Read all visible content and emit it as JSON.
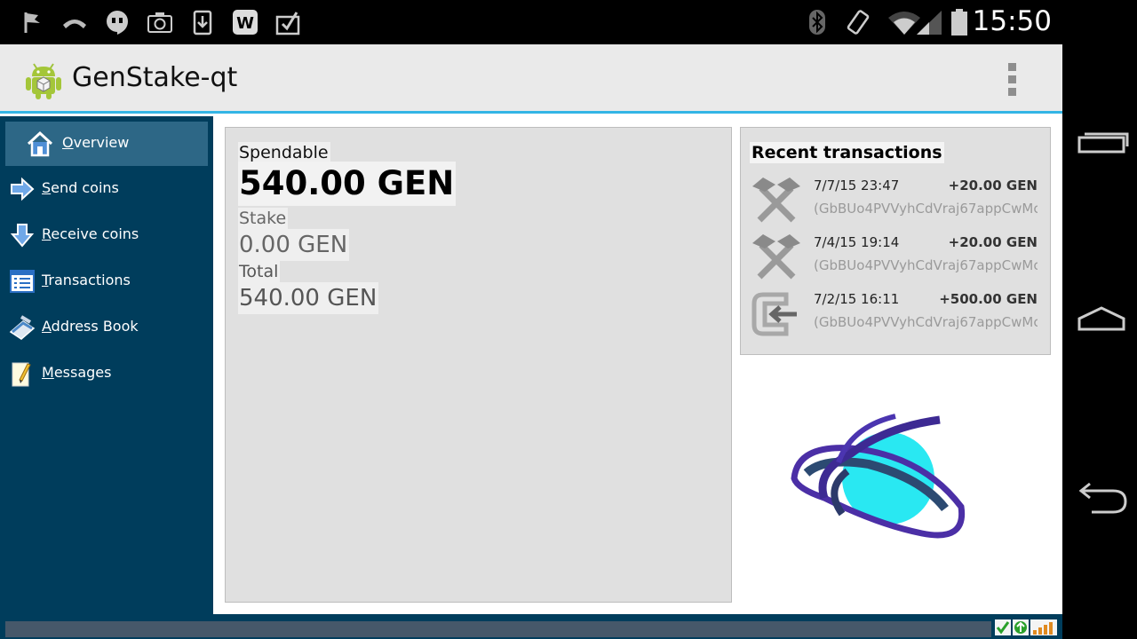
{
  "status_bar": {
    "clock": "15:50",
    "icons": [
      "notification-flag-icon",
      "missed-call-icon",
      "hangouts-icon",
      "camera-icon",
      "download-icon",
      "word-app-icon",
      "clipboard-check-icon",
      "bluetooth-icon",
      "screen-rotation-icon",
      "wifi-icon",
      "signal-icon",
      "battery-icon"
    ]
  },
  "navigation_bar": {
    "buttons": [
      "recent-apps",
      "home",
      "back"
    ]
  },
  "app": {
    "title": "GenStake-qt",
    "icon": "android-robot-icon",
    "menu_icon": "overflow-menu-icon",
    "accent_color": "#33b5e5",
    "sidebar_color": "#003d5c"
  },
  "sidebar": {
    "items": [
      {
        "label": "Overview",
        "icon": "home-icon",
        "active": true
      },
      {
        "label": "Send coins",
        "icon": "send-arrow-icon",
        "active": false
      },
      {
        "label": "Receive coins",
        "icon": "receive-arrow-icon",
        "active": false
      },
      {
        "label": "Transactions",
        "icon": "transactions-list-icon",
        "active": false
      },
      {
        "label": "Address Book",
        "icon": "address-book-icon",
        "active": false
      },
      {
        "label": "Messages",
        "icon": "notepad-icon",
        "active": false
      }
    ]
  },
  "balance": {
    "spendable_label": "Spendable",
    "spendable_value": "540.00 GEN",
    "stake_label": "Stake",
    "stake_value": "0.00 GEN",
    "total_label": "Total",
    "total_value": "540.00 GEN"
  },
  "recent_transactions": {
    "title": "Recent transactions",
    "items": [
      {
        "date": "7/7/15 23:47",
        "amount": "+20.00 GEN",
        "address": "(GbBUo4PVVyhCdVraj67appCwMc",
        "icon": "mining-hammers-icon"
      },
      {
        "date": "7/4/15 19:14",
        "amount": "+20.00 GEN",
        "address": "(GbBUo4PVVyhCdVraj67appCwMc",
        "icon": "mining-hammers-icon"
      },
      {
        "date": "7/2/15 16:11",
        "amount": "+500.00 GEN",
        "address": "(GbBUo4PVVyhCdVraj67appCwMc",
        "icon": "received-coins-icon"
      }
    ]
  },
  "logo": {
    "icon": "genstake-galaxy-logo"
  },
  "status_strip": {
    "icons": [
      "synced-checkmark-icon",
      "staking-status-icon",
      "connections-signal-icon"
    ]
  }
}
